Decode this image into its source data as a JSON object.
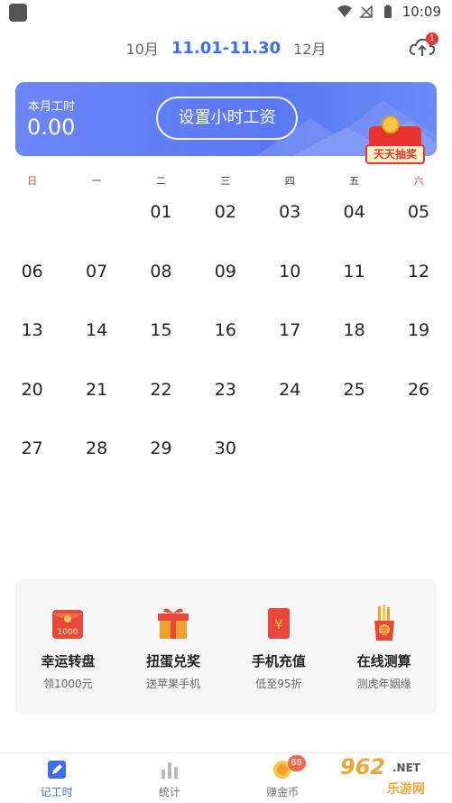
{
  "status_bar": {
    "time": "10:09"
  },
  "month_nav": {
    "prev": "10月",
    "current": "11.01-11.30",
    "next": "12月"
  },
  "cloud_badge": "1",
  "banner": {
    "hours_label": "本月工时",
    "hours_value": "0.00",
    "wage_button": "设置小时工资",
    "lottery_label": "天天抽奖"
  },
  "weekdays": [
    "日",
    "一",
    "二",
    "三",
    "四",
    "五",
    "六"
  ],
  "days": [
    [
      "",
      "",
      "01",
      "02",
      "03",
      "04",
      "05"
    ],
    [
      "06",
      "07",
      "08",
      "09",
      "10",
      "11",
      "12"
    ],
    [
      "13",
      "14",
      "15",
      "16",
      "17",
      "18",
      "19"
    ],
    [
      "20",
      "21",
      "22",
      "23",
      "24",
      "25",
      "26"
    ],
    [
      "27",
      "28",
      "29",
      "30",
      "",
      "",
      ""
    ]
  ],
  "today": "29",
  "promos": [
    {
      "title": "幸运转盘",
      "sub": "领1000元",
      "icon": "red-envelope-1000-icon",
      "icon_text": "1000"
    },
    {
      "title": "扭蛋兑奖",
      "sub": "送苹果手机",
      "icon": "gift-box-icon"
    },
    {
      "title": "手机充值",
      "sub": "低至95折",
      "icon": "red-packet-yen-icon",
      "icon_text": "¥"
    },
    {
      "title": "在线测算",
      "sub": "测虎年姻缘",
      "icon": "fortune-sticks-icon",
      "icon_text": "签"
    }
  ],
  "tabs": [
    {
      "label": "记工时",
      "icon": "edit-icon",
      "active": true
    },
    {
      "label": "统计",
      "icon": "bar-chart-icon",
      "active": false
    },
    {
      "label": "赚金币",
      "icon": "coin-icon",
      "active": false,
      "badge": "88"
    },
    {
      "label": "",
      "icon": "",
      "active": false
    }
  ],
  "watermark": {
    "brand": "962",
    "net": ".NET",
    "cn": "乐游网"
  },
  "colors": {
    "accent": "#3b6ff0",
    "weekend": "#e04a3a",
    "today_bg": "#fdf3c6"
  }
}
